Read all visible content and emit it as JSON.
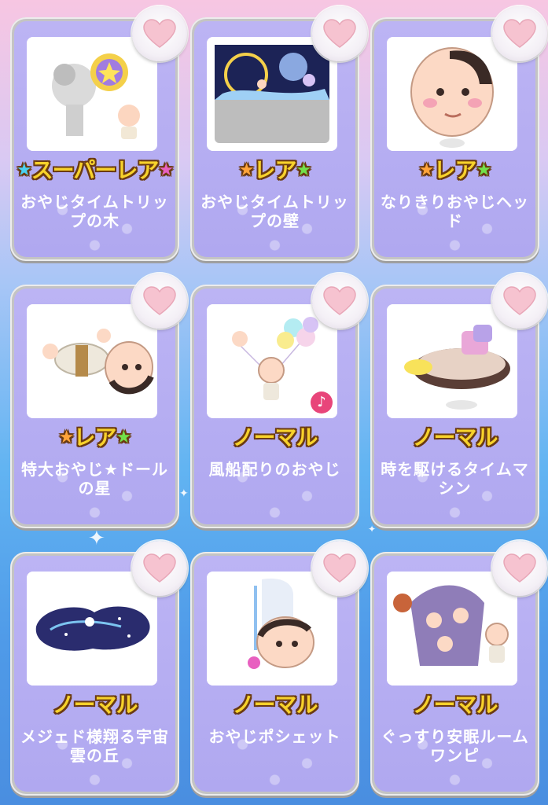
{
  "items": [
    {
      "name": "おやじタイムトリップの木",
      "rarity": "スーパーレア",
      "rarity_type": "super-rare",
      "icon": "tree-icon"
    },
    {
      "name": "おやじタイムトリップの壁",
      "rarity": "レア",
      "rarity_type": "rare",
      "icon": "wall-icon"
    },
    {
      "name": "なりきりおやじヘッド",
      "rarity": "レア",
      "rarity_type": "rare",
      "icon": "head-icon"
    },
    {
      "name": "特大おやじ★ドールの星",
      "rarity": "レア",
      "rarity_type": "rare",
      "icon": "doll-icon"
    },
    {
      "name": "風船配りのおやじ",
      "rarity": "ノーマル",
      "rarity_type": "normal",
      "icon": "balloon-icon",
      "has_sound": true
    },
    {
      "name": "時を駆けるタイムマシン",
      "rarity": "ノーマル",
      "rarity_type": "normal",
      "icon": "time-machine-icon"
    },
    {
      "name": "メジェド様翔る宇宙雲の丘",
      "rarity": "ノーマル",
      "rarity_type": "normal",
      "icon": "space-cloud-icon"
    },
    {
      "name": "おやじポシェット",
      "rarity": "ノーマル",
      "rarity_type": "normal",
      "icon": "pochette-icon"
    },
    {
      "name": "ぐっすり安眠ルームワンピ",
      "rarity": "ノーマル",
      "rarity_type": "normal",
      "icon": "pajama-icon"
    }
  ],
  "colors": {
    "rarity_text": "#f7d22b",
    "card_bg": "#b4acf2",
    "heart_fill": "#f6c3d0"
  }
}
